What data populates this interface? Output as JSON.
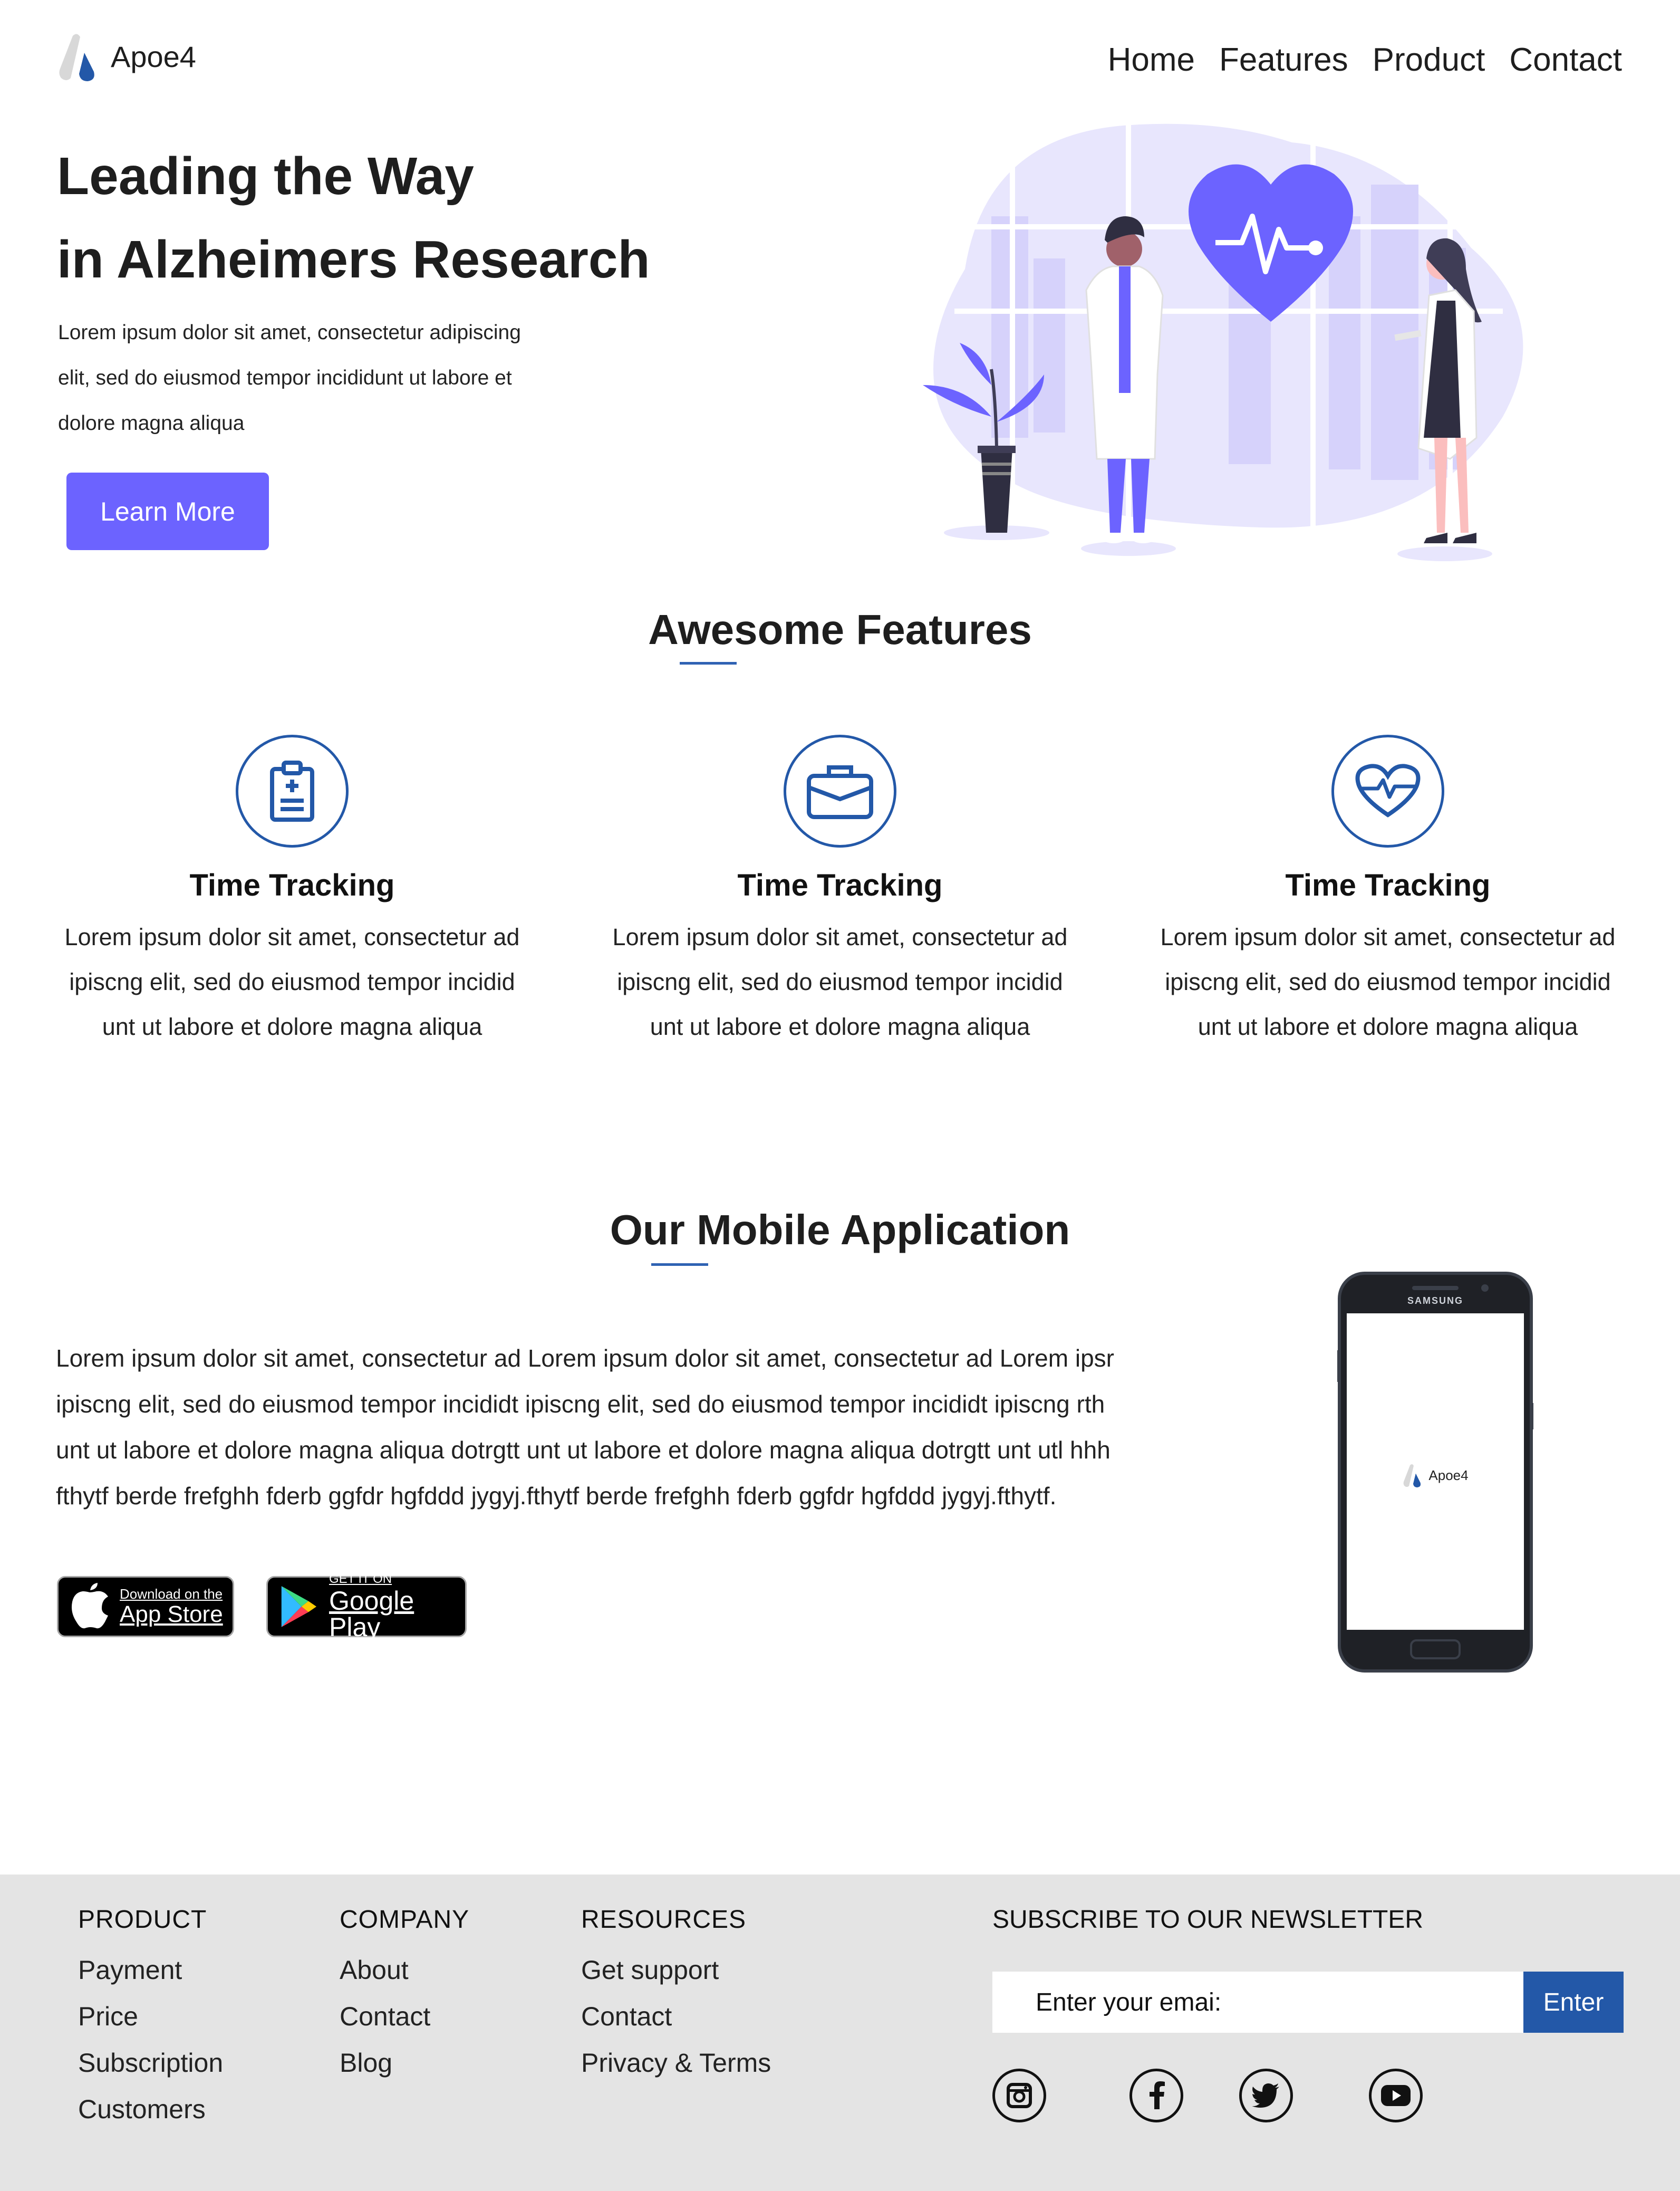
{
  "brand": {
    "name": "Apoe4",
    "logo_icon": "apoe4-logo-icon",
    "primary_color": "#6c63ff",
    "accent_color": "#2358a8"
  },
  "nav": {
    "items": [
      "Home",
      "Features",
      "Product",
      "Contact"
    ]
  },
  "hero": {
    "title_line1": "Leading the Way",
    "title_line2": "in Alzheimers Research",
    "desc_line1": "Lorem ipsum dolor sit amet, consectetur adipiscing",
    "desc_line2": "elit, sed do eiusmod tempor incididunt ut labore et",
    "desc_line3": "dolore magna aliqua",
    "button": "Learn More",
    "illustration": "doctors-heart-illustration"
  },
  "features": {
    "title": "Awesome Features",
    "items": [
      {
        "icon": "clipboard-medical-icon",
        "title": "Time Tracking",
        "line1": "Lorem ipsum dolor sit amet, consectetur ad",
        "line2": "ipiscng elit, sed do eiusmod tempor incidid",
        "line3": "unt ut labore et dolore magna aliqua"
      },
      {
        "icon": "briefcase-icon",
        "title": "Time Tracking",
        "line1": "Lorem ipsum dolor sit amet, consectetur ad",
        "line2": "ipiscng elit, sed do eiusmod tempor incidid",
        "line3": "unt ut labore et dolore magna aliqua"
      },
      {
        "icon": "heart-pulse-icon",
        "title": "Time Tracking",
        "line1": "Lorem ipsum dolor sit amet, consectetur ad",
        "line2": "ipiscng elit, sed do eiusmod tempor incidid",
        "line3": "unt ut labore et dolore magna aliqua"
      }
    ]
  },
  "mobile": {
    "title": "Our Mobile Application",
    "text": "Lorem ipsum dolor sit amet, consectetur ad Lorem ipsum dolor sit amet, consectetur ad Lorem ipsr\nipiscng elit, sed do eiusmod tempor incididt ipiscng elit, sed do eiusmod tempor incididt ipiscng rth\nunt ut labore et dolore magna aliqua dotrgtt unt ut labore et dolore magna aliqua dotrgtt unt utl hhh\nfthytf berde frefghh fderb ggfdr hgfddd jygyj.fthytf berde frefghh fderb ggfdr hgfddd jygyj.fthytf.",
    "appstore_small": "Download on the",
    "appstore_big": "App Store",
    "googleplay_small": "GET IT ON",
    "googleplay_big": "Google Play",
    "phone_brand": "SAMSUNG",
    "phone_app_name": "Apoe4"
  },
  "footer": {
    "product": {
      "heading": "PRODUCT",
      "links": [
        "Payment",
        "Price",
        "Subscription",
        "Customers"
      ]
    },
    "company": {
      "heading": "COMPANY",
      "links": [
        "About",
        "Contact",
        "Blog"
      ]
    },
    "resources": {
      "heading": "RESOURCES",
      "links": [
        "Get support",
        "Contact",
        "Privacy & Terms"
      ]
    },
    "newsletter": {
      "heading": "SUBSCRIBE TO OUR NEWSLETTER",
      "placeholder": "Enter your emai:",
      "button": "Enter"
    },
    "social": [
      "instagram-icon",
      "facebook-icon",
      "twitter-icon",
      "youtube-icon"
    ]
  }
}
